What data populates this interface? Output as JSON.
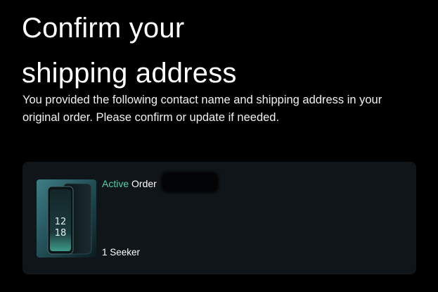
{
  "header": {
    "title_line1": "Confirm your",
    "title_line2": "shipping address",
    "description": "You provided the following contact name and shipping address in your original order. Please confirm or update if needed."
  },
  "order_card": {
    "status_active": "Active",
    "status_order": "Order",
    "item_quantity_name": "1 Seeker",
    "phone_screen_time_hours": "12",
    "phone_screen_time_minutes": "18"
  },
  "colors": {
    "background": "#000000",
    "card_background": "#0f1518",
    "accent_green": "#4fd1a5",
    "text_primary": "#ffffff"
  }
}
